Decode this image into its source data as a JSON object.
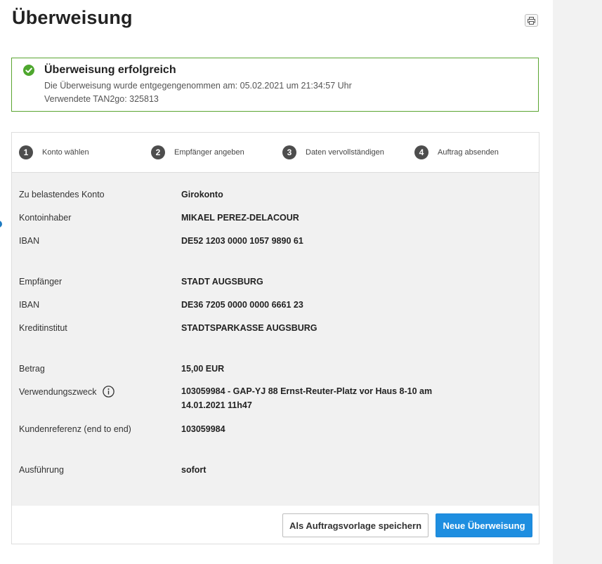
{
  "page": {
    "title": "Überweisung",
    "print_icon": "printer-icon"
  },
  "success": {
    "icon": "check-circle-icon",
    "title": "Überweisung erfolgreich",
    "line1": "Die Überweisung wurde entgegengenommen am: 05.02.2021 um 21:34:57 Uhr",
    "line2": "Verwendete TAN2go: 325813",
    "border_color": "#5aa531"
  },
  "steps": [
    {
      "num": "1",
      "label": "Konto wählen"
    },
    {
      "num": "2",
      "label": "Empfänger angeben"
    },
    {
      "num": "3",
      "label": "Daten vervollständigen"
    },
    {
      "num": "4",
      "label": "Auftrag absenden"
    }
  ],
  "details": {
    "debit_account": {
      "label": "Zu belastendes Konto",
      "value": "Girokonto"
    },
    "holder": {
      "label": "Kontoinhaber",
      "value": "MIKAEL PEREZ-DELACOUR"
    },
    "debit_iban": {
      "label": "IBAN",
      "value": "DE52 1203 0000 1057 9890 61"
    },
    "recipient": {
      "label": "Empfänger",
      "value": "STADT AUGSBURG"
    },
    "recipient_iban": {
      "label": "IBAN",
      "value": "DE36 7205 0000 0000 6661 23"
    },
    "bank": {
      "label": "Kreditinstitut",
      "value": "STADTSPARKASSE AUGSBURG"
    },
    "amount": {
      "label": "Betrag",
      "value": "15,00 EUR"
    },
    "purpose": {
      "label": "Verwendungszweck",
      "value": "103059984 - GAP-YJ 88 Ernst-Reuter-Platz vor Haus 8-10 am 14.01.2021 11h47",
      "icon": "info-icon"
    },
    "reference": {
      "label": "Kundenreferenz (end to end)",
      "value": "103059984"
    },
    "execution": {
      "label": "Ausführung",
      "value": "sofort"
    }
  },
  "buttons": {
    "save_template": "Als Auftragsvorlage speichern",
    "new_transfer": "Neue Überweisung",
    "primary_color": "#1e8ee0"
  }
}
